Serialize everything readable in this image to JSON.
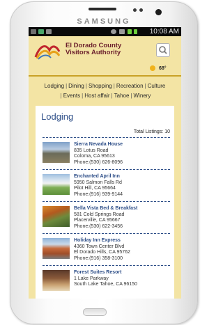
{
  "device": {
    "brand": "SAMSUNG"
  },
  "status_bar": {
    "time": "10:08 AM"
  },
  "header": {
    "logo_line1": "El Dorado County",
    "logo_line2": "Visitors Authority",
    "temperature": "68°"
  },
  "nav": {
    "row1": [
      "Lodging",
      "Dining",
      "Shopping",
      "Recreation",
      "Culture"
    ],
    "row2": [
      "Events",
      "Host affair",
      "Tahoe",
      "Winery"
    ]
  },
  "main": {
    "title": "Lodging",
    "total_listings": "Total Listings: 10",
    "listings": [
      {
        "name": "Sierra Nevada House",
        "address": "835 Lotus Road",
        "city": "Coloma, CA 95613",
        "phone": "Phone:(530) 626-8096"
      },
      {
        "name": "Enchanted April Inn",
        "address": "5950 Salmon Falls Rd",
        "city": "Pilot Hill, CA 95664",
        "phone": "Phone:(916) 939-9144"
      },
      {
        "name": "Bella Vista Bed & Breakfast",
        "address": "581 Cold Springs Road",
        "city": "Placerville, CA 95667",
        "phone": "Phone:(530) 622-3456"
      },
      {
        "name": "Holiday Inn Express",
        "address": "4360 Town Center Blvd",
        "city": "El Dorado Hills, CA 95762",
        "phone": "Phone:(916) 358-3100"
      },
      {
        "name": "Forest Suites Resort",
        "address": "1 Lake Parkway",
        "city": "South Lake Tahoe, CA 96150",
        "phone": ""
      }
    ]
  },
  "icons": [
    "search-icon",
    "sun-icon",
    "logo-icon",
    "wifi-icon",
    "alarm-icon",
    "battery-icon",
    "signal-icon"
  ],
  "colors": {
    "header_bg": "#f3e4a4",
    "link_blue": "#2c4d87",
    "logo_red": "#6a1e2b"
  }
}
